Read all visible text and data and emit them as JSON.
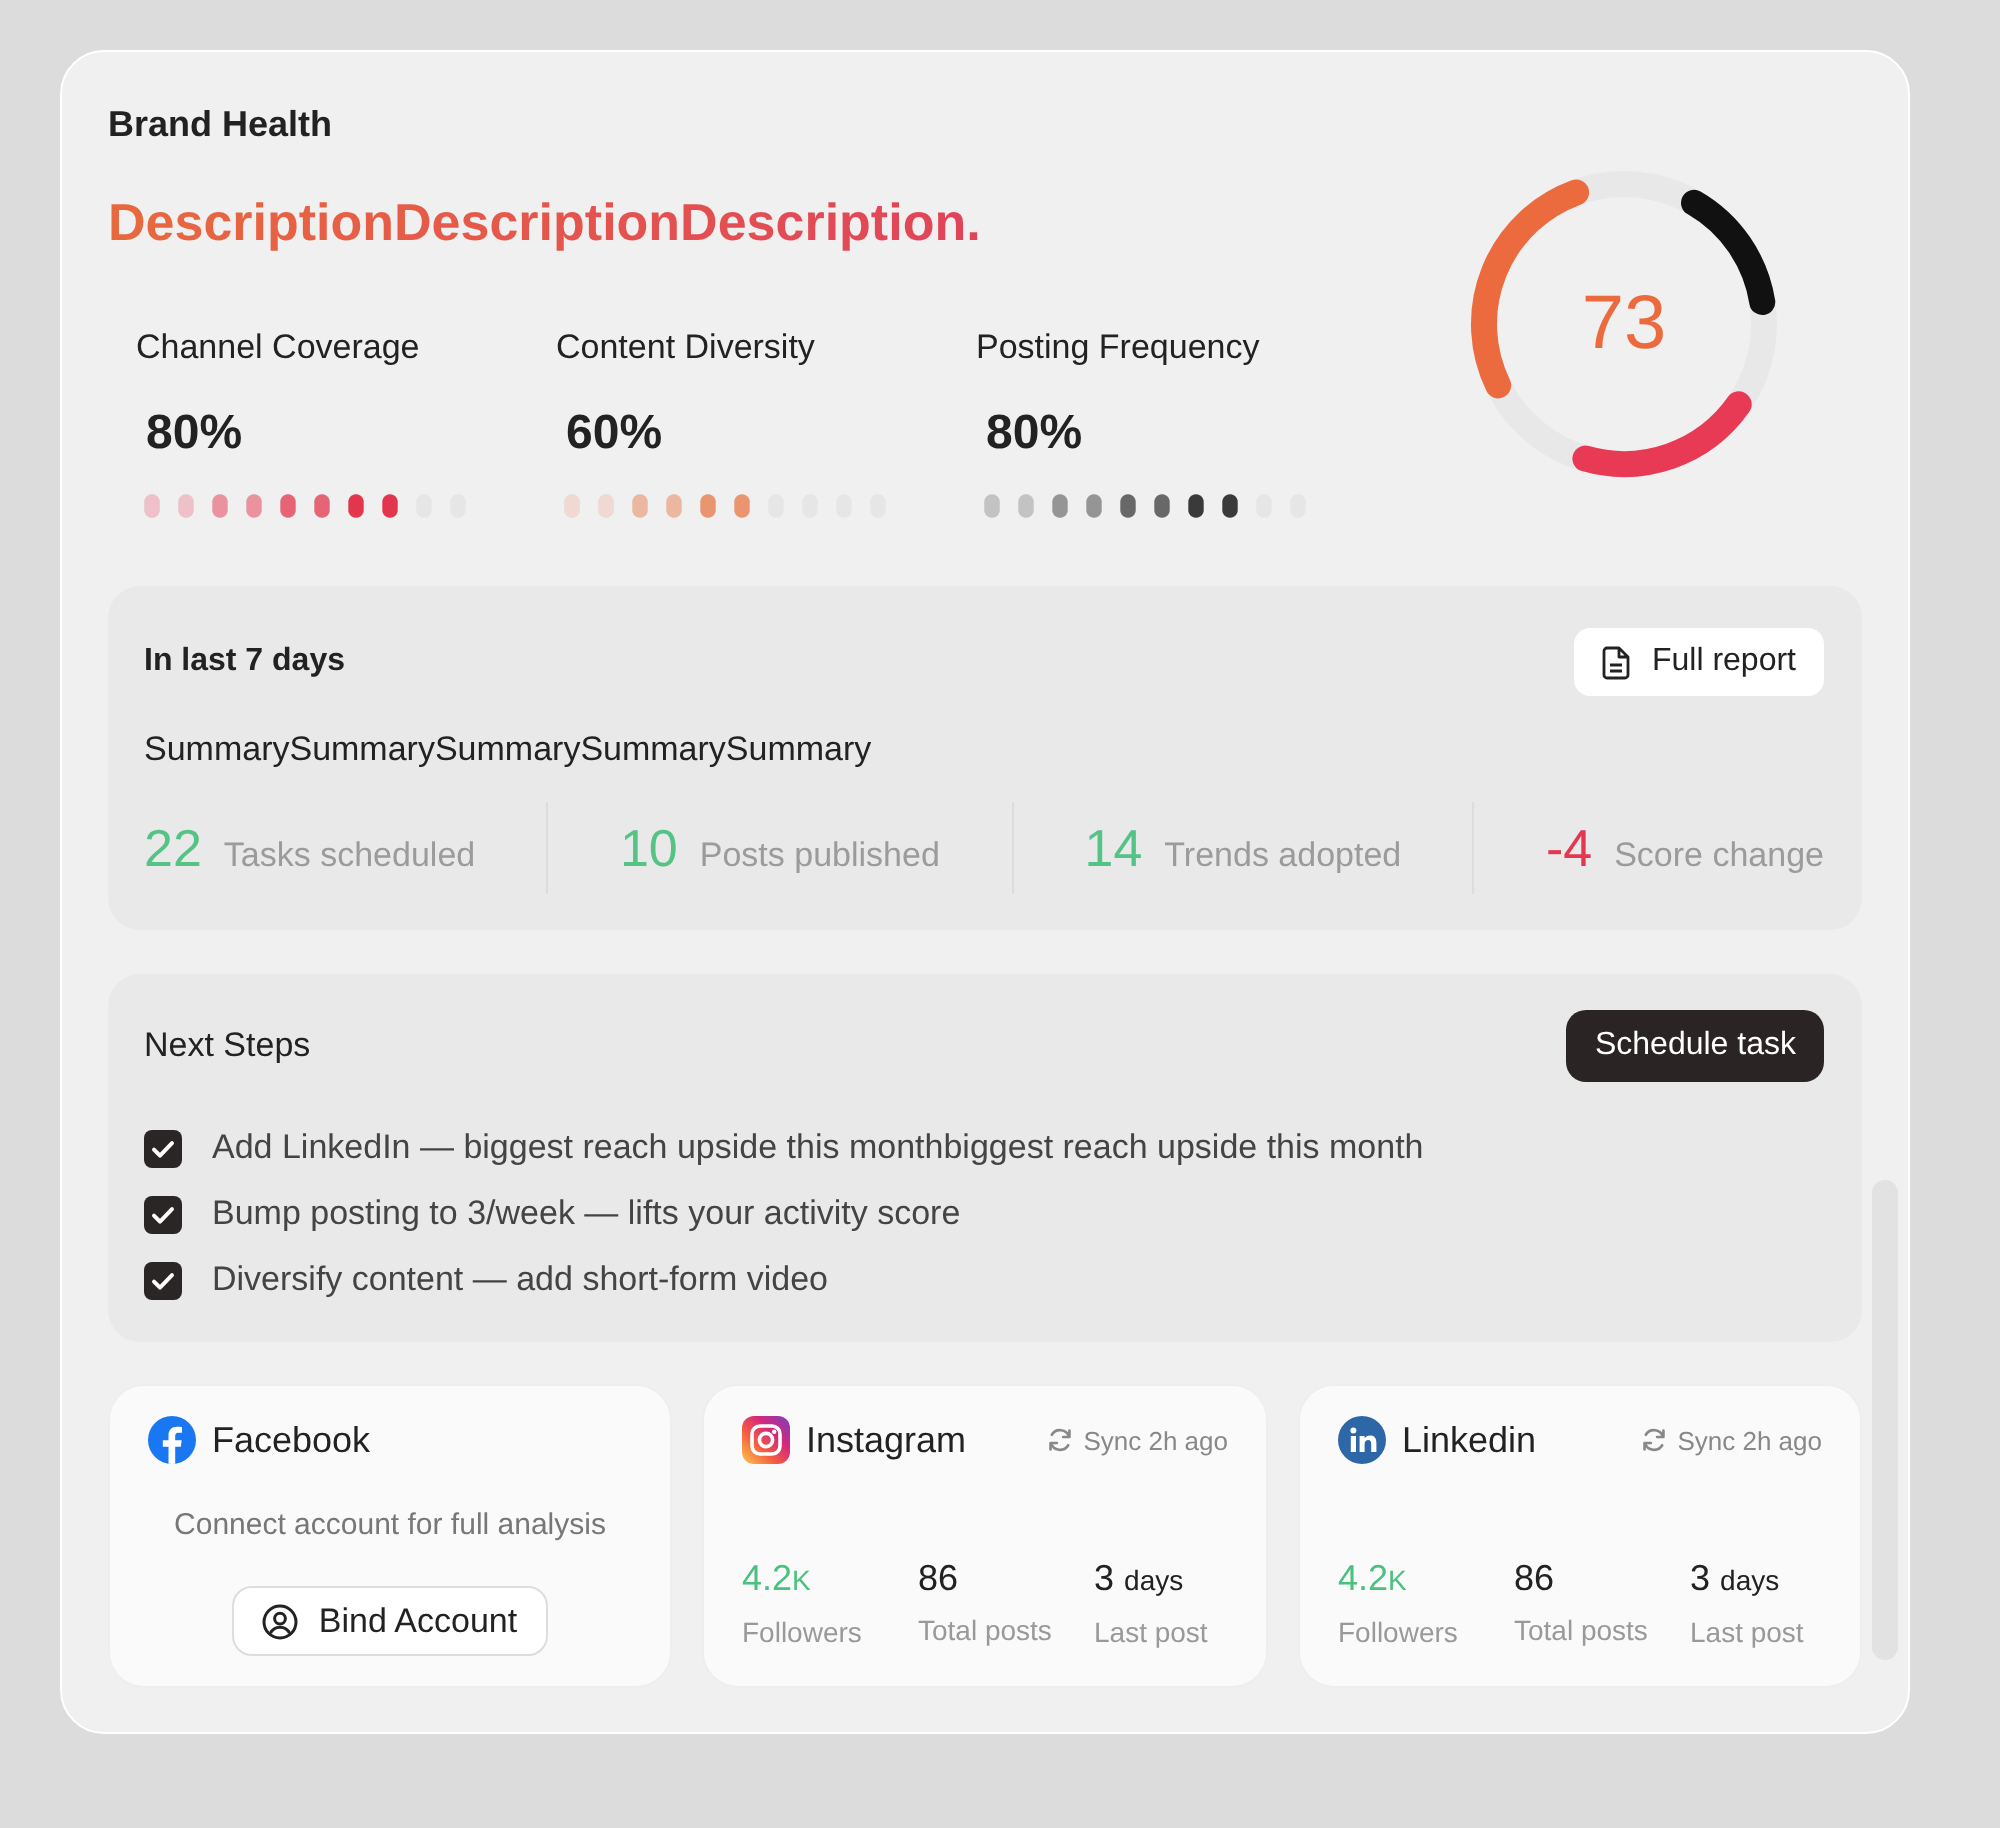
{
  "header": {
    "title": "Brand Health",
    "description": "DescriptionDescriptionDescription.",
    "score": "73"
  },
  "metrics": [
    {
      "label": "Channel Coverage",
      "value": "80%",
      "level": 0.8,
      "color": "#e3354c"
    },
    {
      "label": "Content Diversity",
      "value": "60%",
      "level": 0.6,
      "color": "#ea9470"
    },
    {
      "label": "Posting Frequency",
      "value": "80%",
      "level": 0.8,
      "color": "#3a3a3a"
    }
  ],
  "summary": {
    "title": "In last 7 days",
    "button": "Full report",
    "text": "SummarySummarySummarySummarySummary",
    "stats": [
      {
        "value": "22",
        "label": "Tasks scheduled",
        "color": "#55c386"
      },
      {
        "value": "10",
        "label": "Posts published",
        "color": "#55c386"
      },
      {
        "value": "14",
        "label": "Trends adopted",
        "color": "#55c386"
      },
      {
        "value": "-4",
        "label": "Score change",
        "color": "#e3384f"
      }
    ]
  },
  "next_steps": {
    "title": "Next Steps",
    "button": "Schedule task",
    "items": [
      {
        "text": "Add LinkedIn — biggest reach upside this monthbiggest reach upside this month",
        "checked": true
      },
      {
        "text": "Bump posting to 3/week — lifts your activity score",
        "checked": true
      },
      {
        "text": "Diversify content — add short-form video",
        "checked": true
      }
    ]
  },
  "accounts": [
    {
      "kind": "facebook",
      "name": "Facebook",
      "connected": false,
      "message": "Connect account for full analysis",
      "button": "Bind Account"
    },
    {
      "kind": "instagram",
      "name": "Instagram",
      "connected": true,
      "sync": "Sync 2h ago",
      "stats": [
        {
          "value": "4.2",
          "unit": "K",
          "unit_space": false,
          "label": "Followers",
          "highlight": true
        },
        {
          "value": "86",
          "label": "Total posts",
          "highlight": false
        },
        {
          "value": "3",
          "unit": "days",
          "unit_space": true,
          "label": "Last post",
          "highlight": false
        }
      ]
    },
    {
      "kind": "linkedin",
      "name": "Linkedin",
      "connected": true,
      "sync": "Sync 2h ago",
      "stats": [
        {
          "value": "4.2",
          "unit": "K",
          "unit_space": false,
          "label": "Followers",
          "highlight": true
        },
        {
          "value": "86",
          "label": "Total posts",
          "highlight": false
        },
        {
          "value": "3",
          "unit": "days",
          "unit_space": true,
          "label": "Last post",
          "highlight": false
        }
      ]
    }
  ]
}
